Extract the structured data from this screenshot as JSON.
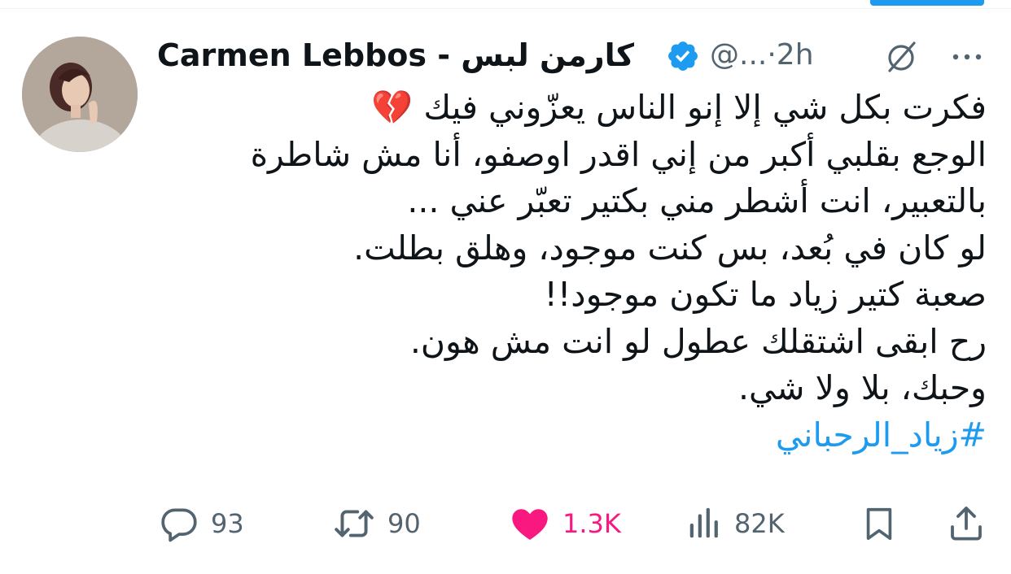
{
  "author": {
    "display_name": "Carmen Lebbos - كارمن لبس",
    "handle": "@...",
    "separator": "·",
    "time": "2h",
    "verified": true
  },
  "tweet": {
    "lines": [
      "فكرت بكل شي إلا إنو الناس يعزّوني فيك 💔",
      "الوجع بقلبي أكبر من إني اقدر اوصفو، أنا مش شاطرة",
      "بالتعبير، انت أشطر مني بكتير تعبّر عني ...",
      "لو كان في بُعد، بس كنت موجود، وهلق بطلت.",
      "صعبة كتير زياد ما تكون موجود!!",
      "رح ابقى اشتقلك عطول لو انت مش هون.",
      "وحبك، بلا ولا شي."
    ],
    "hashtag": "#زياد_الرحباني"
  },
  "actions": {
    "replies": "93",
    "reposts": "90",
    "likes": "1.3K",
    "views": "82K"
  },
  "colors": {
    "accent": "#1d9bf0",
    "like": "#f91880",
    "muted": "#536471",
    "text": "#0f1419"
  },
  "icons": {
    "verified": "verified-badge-icon",
    "grok": "grok-icon",
    "more": "more-dots-icon",
    "reply": "reply-bubble-icon",
    "repost": "repost-arrows-icon",
    "like": "heart-filled-icon",
    "views": "views-bars-icon",
    "bookmark": "bookmark-icon",
    "share": "share-upload-icon"
  }
}
